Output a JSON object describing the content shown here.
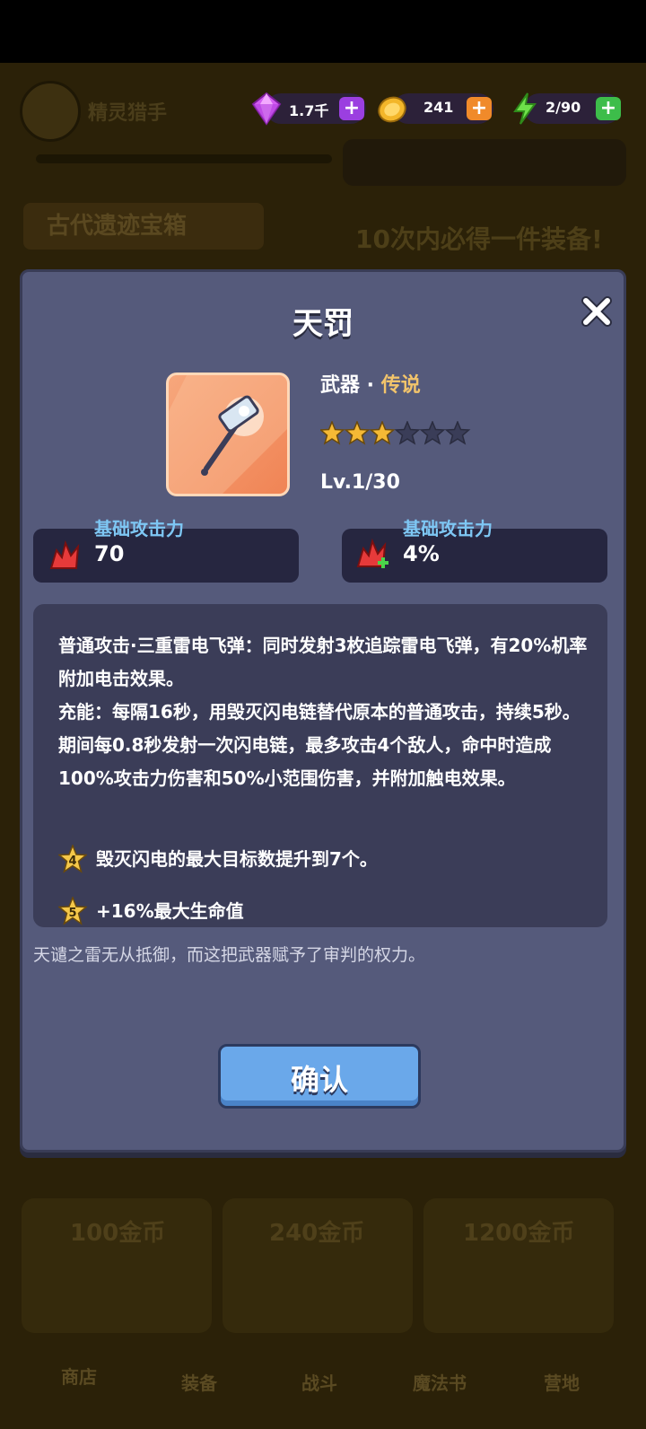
{
  "background": {
    "player_name": "精灵猎手",
    "chest_banner": "古代遗迹宝箱",
    "guarantee_text": "10次内必得一件装备!",
    "shop_prices": [
      "100金币",
      "240金币",
      "1200金币"
    ],
    "nav": [
      "商店",
      "装备",
      "战斗",
      "魔法书",
      "营地"
    ]
  },
  "resources": {
    "gems": "1.7千",
    "gold": "241",
    "energy": "2/90"
  },
  "modal": {
    "title": "天罚",
    "type_label": "武器 · ",
    "rarity": "传说",
    "stars_filled": 3,
    "stars_total": 6,
    "level": "Lv.1/30",
    "stat1_label": "基础攻击力",
    "stat1_value": "70",
    "stat2_label": "基础攻击力",
    "stat2_value": "4%",
    "desc_line1": "普通攻击·三重雷电飞弹：同时发射3枚追踪雷电飞弹，有20%机率附加电击效果。",
    "desc_line2": "充能：每隔16秒，用毁灭闪电链替代原本的普通攻击，持续5秒。期间每0.8秒发射一次闪电链，最多攻击4个敌人，命中时造成100%攻击力伤害和50%小范围伤害，并附加触电效果。",
    "star4_badge": "4",
    "star4_text": "毁灭闪电的最大目标数提升到7个。",
    "star5_badge": "5",
    "star5_text": "+16%最大生命值",
    "flavor": "天谴之雷无从抵御，而这把武器赋予了审判的权力。",
    "confirm": "确认"
  },
  "colors": {
    "modal_bg": "#555a7b",
    "rarity": "#f2c46b",
    "stat_label": "#7ec7f4",
    "confirm": "#6aa8ea"
  }
}
